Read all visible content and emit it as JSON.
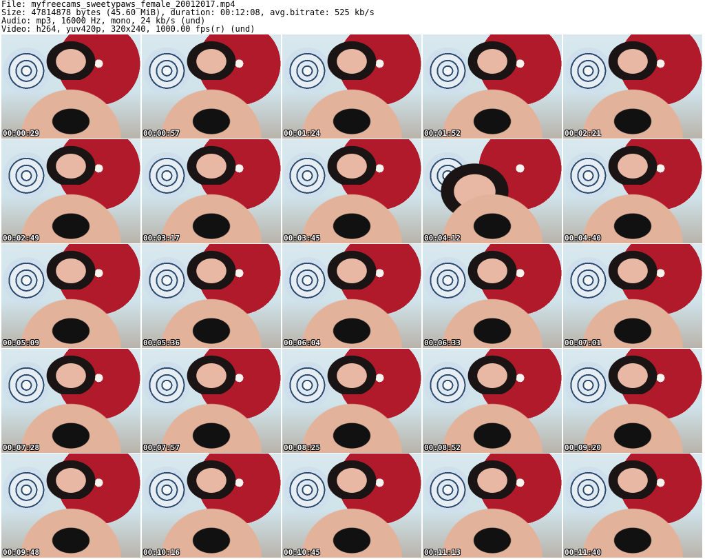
{
  "header": {
    "file_line": "File: myfreecams_sweetypaws_female_20012017.mp4",
    "size_line": "Size: 47814878 bytes (45.60 MiB), duration: 00:12:08, avg.bitrate: 525 kb/s",
    "audio_line": "Audio: mp3, 16000 Hz, mono, 24 kb/s (und)",
    "video_line": "Video: h264, yuv420p, 320x240, 1000.00 fps(r) (und)"
  },
  "thumbnails": [
    "00:00:29",
    "00:00:57",
    "00:01:24",
    "00:01:52",
    "00:02:21",
    "00:02:49",
    "00:03:17",
    "00:03:45",
    "00:04:12",
    "00:04:40",
    "00:05:09",
    "00:05:36",
    "00:06:04",
    "00:06:33",
    "00:07:01",
    "00:07:28",
    "00:07:57",
    "00:08:25",
    "00:08:52",
    "00:09:20",
    "00:09:48",
    "00:10:16",
    "00:10:45",
    "00:11:13",
    "00:11:40"
  ]
}
